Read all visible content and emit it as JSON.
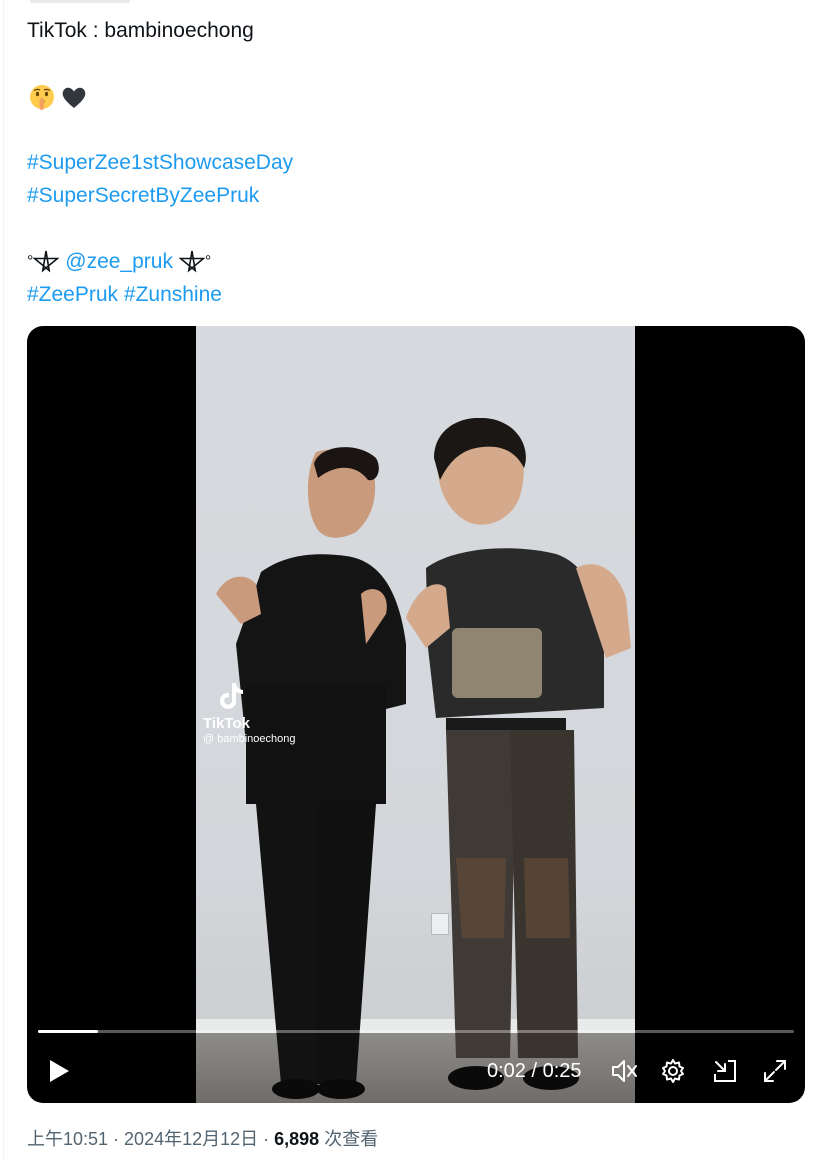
{
  "tweet": {
    "line1": "TikTok : bambinoechong",
    "emojis": [
      "shushing-face-emoji",
      "black-heart-emoji"
    ],
    "hashtag1": "#SuperZee1stShowcaseDay",
    "hashtag2": "#SuperSecretByZeePruk",
    "deg_left": "°",
    "mention": "@zee_pruk",
    "deg_right": "°",
    "hashtag3": "#ZeePruk",
    "hashtag4": "#Zunshine"
  },
  "video": {
    "watermark_brand": "TikTok",
    "watermark_handle": "@ bambinoechong",
    "current_time": "0:02",
    "separator": " / ",
    "duration": "0:25",
    "progress_fraction": 0.08,
    "icons": [
      "play-icon",
      "volume-icon",
      "settings-icon",
      "dock-icon",
      "fullscreen-icon"
    ]
  },
  "meta": {
    "time": "上午10:51",
    "sep1": " · ",
    "date": "2024年12月12日",
    "sep2": " · ",
    "views_count": "6,898",
    "views_label": " 次查看"
  },
  "colors": {
    "link": "#1d9bf0",
    "text": "#0f1419",
    "secondary": "#536471",
    "video_bg": "#000000"
  }
}
